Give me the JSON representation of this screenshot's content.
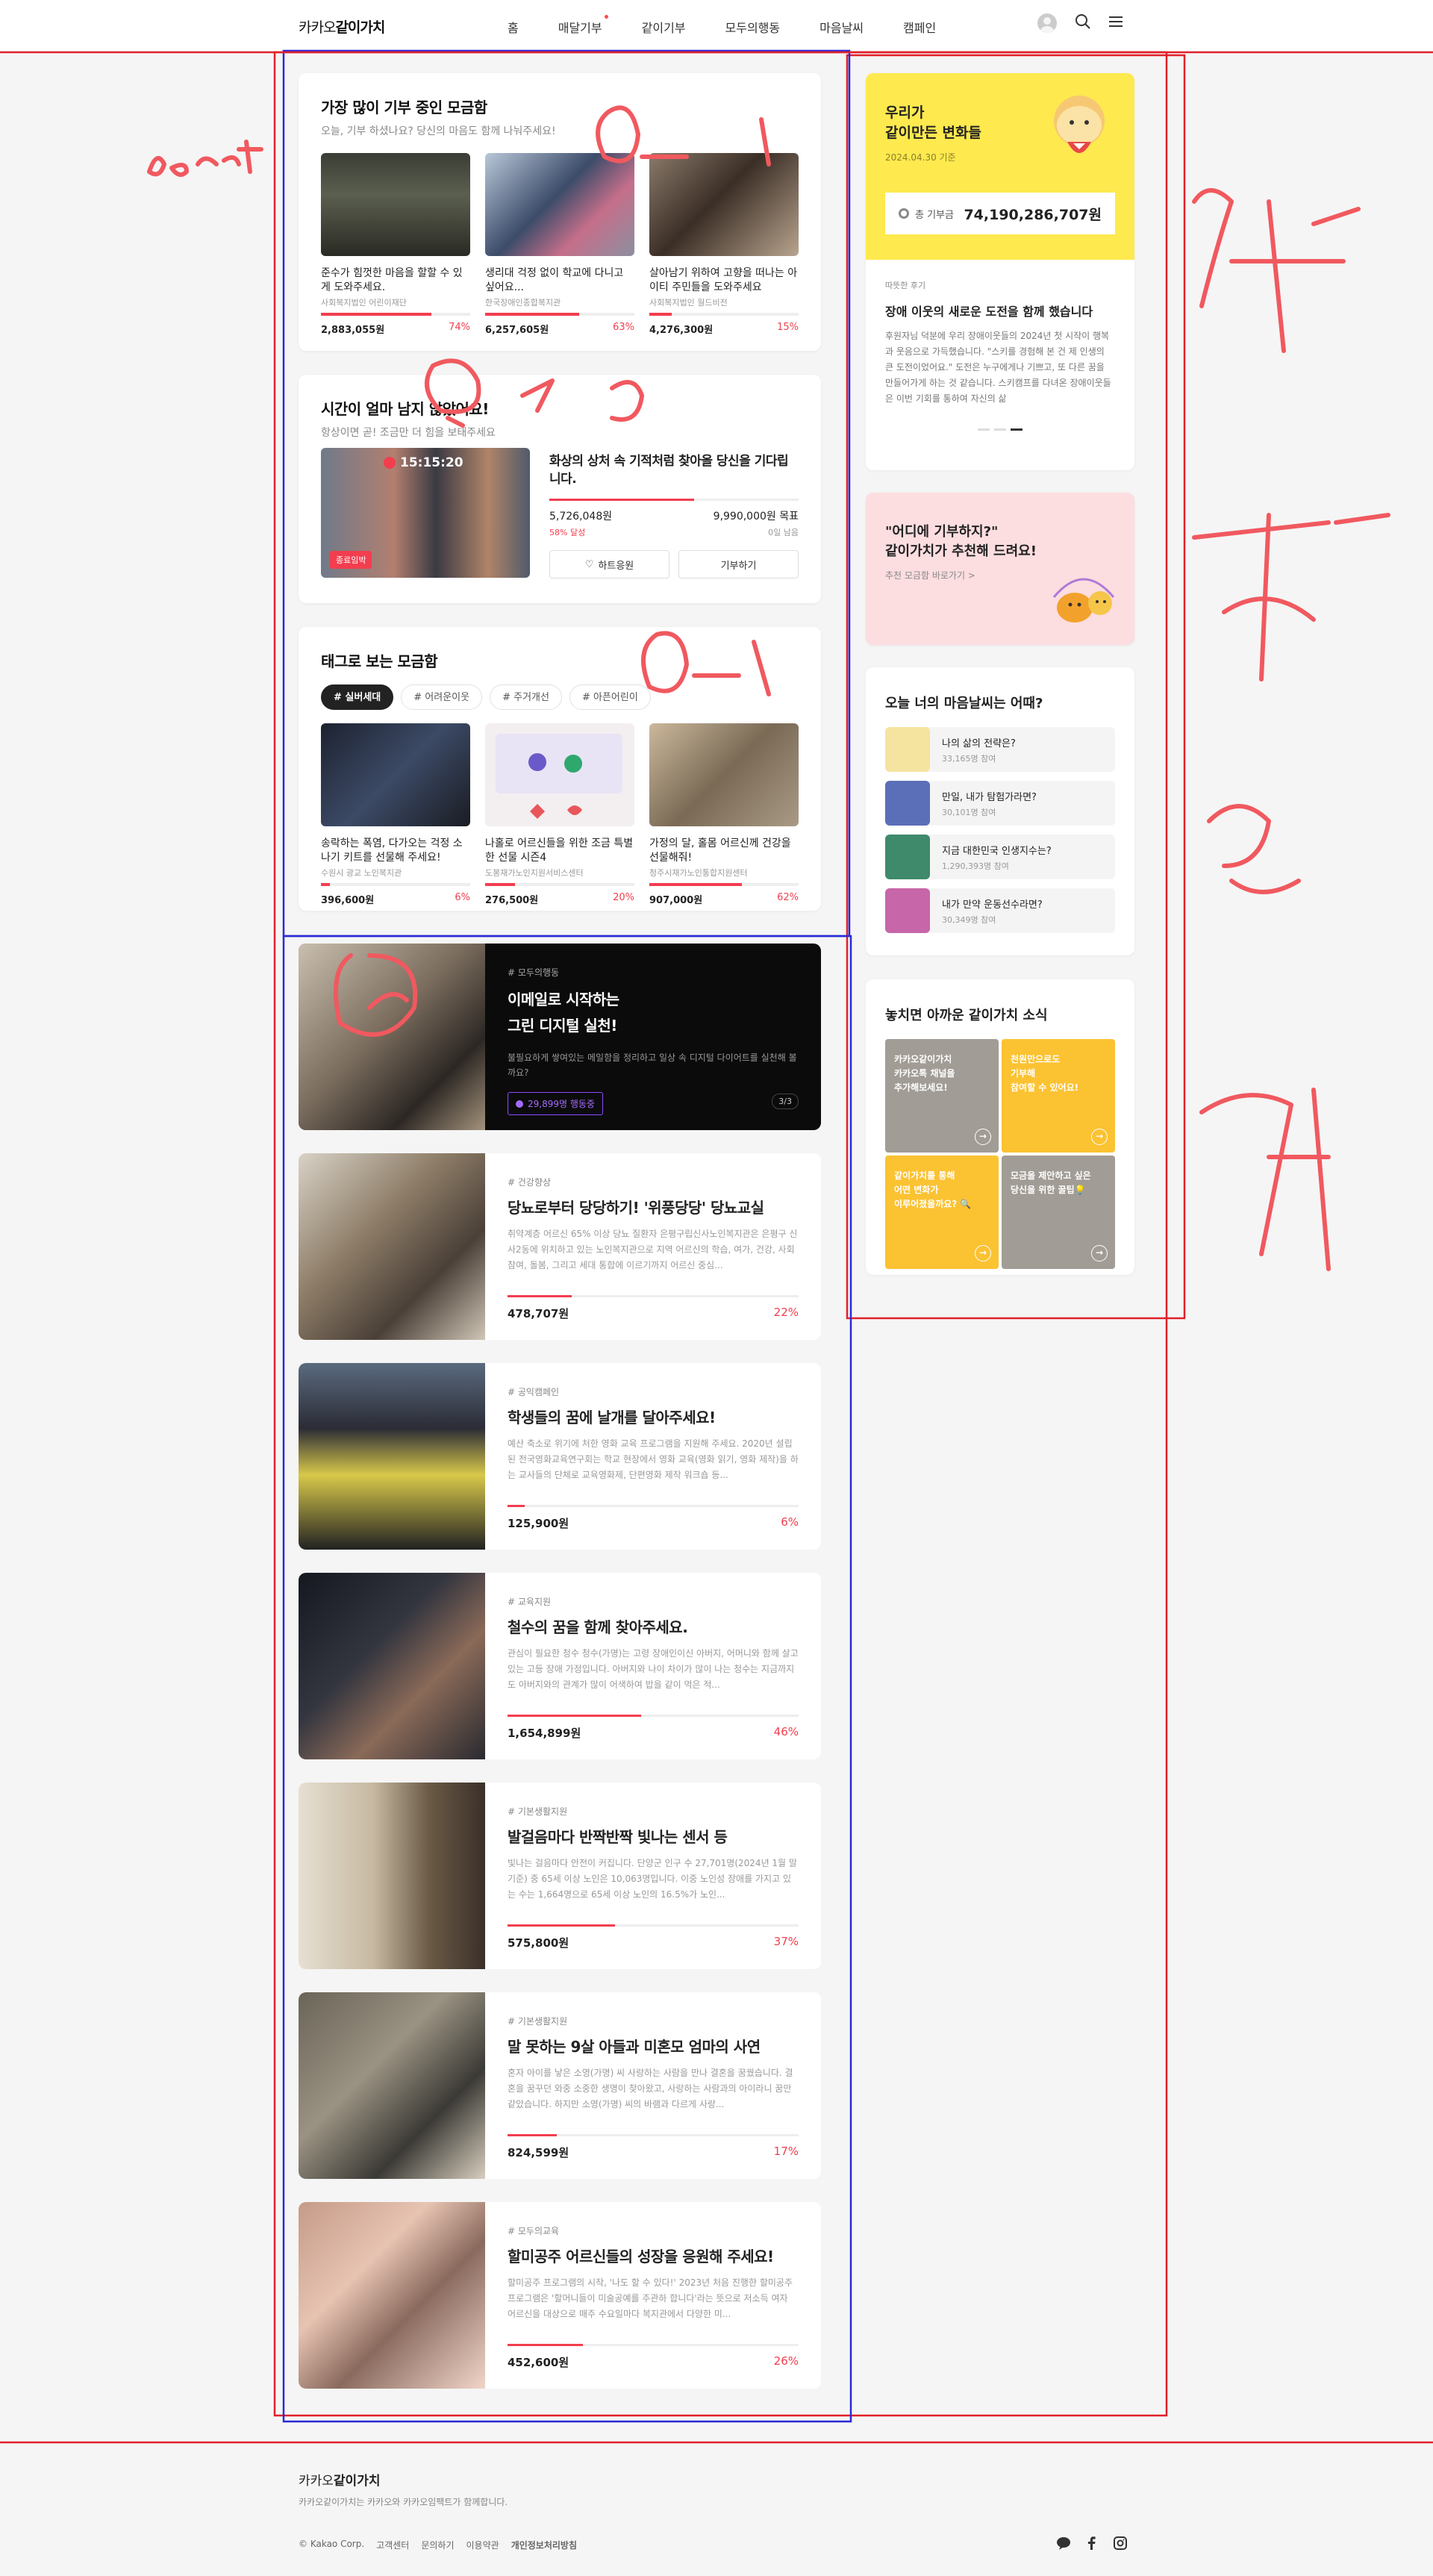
{
  "header": {
    "logo_a": "카카오",
    "logo_b": "같이가치",
    "nav": [
      "홈",
      "매달기부",
      "같이기부",
      "모두의행동",
      "마음날씨",
      "캠페인"
    ]
  },
  "popular": {
    "title": "가장 많이 기부 중인 모금함",
    "subtitle": "오늘, 기부 하셨나요? 당신의 마음도 함께 나눠주세요!",
    "items": [
      {
        "title": "준수가 힘껏한 마음을 할할 수 있게 도와주세요.",
        "org": "사회복지법인 어린이재단",
        "amount": "2,883,055원",
        "pct": "74%",
        "p": 0.74
      },
      {
        "title": "생리대 걱정 없이 학교에 다니고 싶어요...",
        "org": "한국장애인종합복지관",
        "amount": "6,257,605원",
        "pct": "63%",
        "p": 0.63
      },
      {
        "title": "살아남기 위하여 고향을 떠나는 아이티 주민들을 도와주세요",
        "org": "사회복지법인 월드비전",
        "amount": "4,276,300원",
        "pct": "15%",
        "p": 0.15
      }
    ]
  },
  "timeleft": {
    "title": "시간이 얼마 남지 않았어요!",
    "subtitle": "항상이면 곧! 조금만 더 힘을 보태주세요",
    "timer": "15:15:20",
    "badge": "종료임박",
    "ctitle": "화상의 상처 속 기적처럼 찾아올 당신을 기다립니다.",
    "raised": "5,726,048원",
    "goal": "9,990,000원 목표",
    "rate": "58% 달성",
    "dday": "0일 남음",
    "p": 0.58,
    "cheer": "하트응원",
    "donate": "기부하기"
  },
  "tags": {
    "title": "태그로 보는 모금함",
    "chips": [
      "# 실버세대",
      "# 어려운이웃",
      "# 주거개선",
      "# 아픈어린이"
    ],
    "items": [
      {
        "title": "송락하는 폭염, 다가오는 걱정 소나기 키트를 선물해 주세요!",
        "org": "수원시 광교 노인복지관",
        "amount": "396,600원",
        "pct": "6%",
        "p": 0.06
      },
      {
        "title": "나홀로 어르신들을 위한 조금 특별한 선물 시즌4",
        "org": "도봉재가노인지원서비스센터",
        "amount": "276,500원",
        "pct": "20%",
        "p": 0.2
      },
      {
        "title": "가정의 달, 홀몸 어르신께 건강을 선물해줘!",
        "org": "청주시재가노인통합지원센터",
        "amount": "907,000원",
        "pct": "62%",
        "p": 0.62
      }
    ]
  },
  "featured": {
    "cat": "# 모두의행동",
    "t1": "이메일로 시작하는",
    "t2": "그린 디지털 실천!",
    "desc": "불필요하게 쌓여있는 메일함을 정리하고 일상 속 디지털 다이어트를 실천해 볼까요?",
    "count": "29,899명 행동중",
    "page": "3/3"
  },
  "list": [
    {
      "cat": "# 건강향상",
      "title": "당뇨로부터 당당하기! '위풍당당' 당뇨교실",
      "desc": "취약계층 어르신 65% 이상 당뇨 질환자 은평구립신사노인복지관은 은평구 신사2동에 위치하고 있는 노인복지관으로 지역 어르신의 학습, 여가, 건강, 사회 참여, 돌봄, 그리고 세대 통합에 이르기까지 어르신 중심...",
      "amount": "478,707원",
      "pct": "22%",
      "p": 0.22
    },
    {
      "cat": "# 공익캠페인",
      "title": "학생들의 꿈에 날개를 달아주세요!",
      "desc": "예산 축소로 위기에 처한 영화 교육 프로그램을 지원해 주세요. 2020년 설립된 전국영화교육연구회는 학교 현장에서 영화 교육(영화 읽기, 영화 제작)을 하는 교사들의 단체로 교육영화제, 단편영화 제작 워크숍 등...",
      "amount": "125,900원",
      "pct": "6%",
      "p": 0.06
    },
    {
      "cat": "# 교육지원",
      "title": "철수의 꿈을 함께 찾아주세요.",
      "desc": "관심이 필요한 청수 청수(가명)는 고령 장애인이신 아버지, 어머니와 함께 살고 있는 고등 장애 가정입니다. 아버지와 나이 차이가 많이 나는 청수는 지금까지도 아버지와의 관계가 많이 어색하여 밥을 같이 먹은 적...",
      "amount": "1,654,899원",
      "pct": "46%",
      "p": 0.46
    },
    {
      "cat": "# 기본생활지원",
      "title": "발걸음마다 반짝반짝 빛나는 센서 등",
      "desc": "빛나는 걸음마다 안전이 커집니다. 단양군 인구 수 27,701명(2024년 1월 말 기준) 중 65세 이상 노인은 10,063명입니다. 이중 노인성 장애를 가지고 있는 수는 1,664명으로 65세 이상 노인의 16.5%가 노인...",
      "amount": "575,800원",
      "pct": "37%",
      "p": 0.37
    },
    {
      "cat": "# 기본생활지원",
      "title": "말 못하는 9살 아들과 미혼모 엄마의 사연",
      "desc": "혼자 아이를 낳은 소영(가명) 씨 사랑하는 사람을 만나 결혼을 꿈꿨습니다. 결혼을 꿈꾸던 와중 소중한 생명이 찾아왔고, 사랑하는 사람과의 아이라니 꿈만 같았습니다. 하지만 소영(가명) 씨의 바램과 다르게 사랑...",
      "amount": "824,599원",
      "pct": "17%",
      "p": 0.17
    },
    {
      "cat": "# 모두의교육",
      "title": "할미공주 어르신들의 성장을 응원해 주세요!",
      "desc": "할미공주 프로그램의 시작, '나도 할 수 있다!' 2023년 처음 진행한 할미공주 프로그램은 '할머니들이 미술공예를 주관하 합니다'라는 뜻으로 저소득 여자 어르신을 대상으로 매주 수요일마다 복지관에서 다양한 미...",
      "amount": "452,600원",
      "pct": "26%",
      "p": 0.26
    }
  ],
  "change": {
    "t1": "우리가",
    "t2": "같이만든 변화들",
    "date": "2024.04.30 기준",
    "total_label": "총 기부금",
    "total": "74,190,286,707원",
    "review_label": "따뜻한 후기",
    "review_title": "장애 이웃의 새로운 도전을 함께 했습니다",
    "review_body": "후원자님 덕분에 우리 장애이웃들의 2024년 첫 시작이 행복과 웃음으로 가득했습니다. \"스키를 경험해 본 건 제 인생의 큰 도전이었어요.\" 도전은 누구에게나 기쁘고, 또 다른 꿈을 만들어가게 하는 것 같습니다. 스키캠프를 다녀온 장애이웃들은 이번 기회를 통하여 자신의 삶"
  },
  "recommend": {
    "t1": "\"어디에 기부하지?\"",
    "t2": "같이가치가 추천해 드려요!",
    "link": "추천 모금함 바로가기 >"
  },
  "weather": {
    "title": "오늘 너의 마음날씨는 어때?",
    "items": [
      {
        "q": "나의 삶의 전략은?",
        "n": "33,165명 참여"
      },
      {
        "q": "만일, 내가 탐험가라면?",
        "n": "30,101명 참여"
      },
      {
        "q": "지금 대한민국 인생지수는?",
        "n": "1,290,393명 참여"
      },
      {
        "q": "내가 만약 운동선수라면?",
        "n": "30,349명 참여"
      }
    ]
  },
  "news": {
    "title": "놓치면 아까운 같이가치 소식",
    "tiles": [
      {
        "l1": "카카오같이가치",
        "l2": "카카오톡 채널을",
        "l3": "추가해보세요!"
      },
      {
        "l1": "천원만으로도",
        "l2": "기부해",
        "l3": "참여할 수 있어요!"
      },
      {
        "l1": "같이가치를 통해",
        "l2": "어떤 변화가",
        "l3": "이루어졌을까요? 🔍"
      },
      {
        "l1": "모금을 제안하고 싶은",
        "l2": "당신을 위한 꿀팁💡",
        "l3": ""
      }
    ]
  },
  "footer": {
    "logo_a": "카카오",
    "logo_b": "같이가치",
    "desc": "카카오같이가치는 카카오와 카카오임팩트가 함께합니다.",
    "links": [
      "© Kakao Corp.",
      "고객센터",
      "문의하기",
      "이용약관",
      "개인정보처리방침"
    ]
  },
  "annotations": {
    "a1": "donat",
    "a2": "0-1",
    "a3": "0-9",
    "a4": "0-2",
    "a5": "3"
  },
  "colors": {
    "accent": "#f23e4f",
    "yellow": "#fee94e",
    "pink": "#fcdde0",
    "annot_red": "#f0595f",
    "box_blue": "#2a2ad8",
    "box_red": "#e0202a"
  }
}
